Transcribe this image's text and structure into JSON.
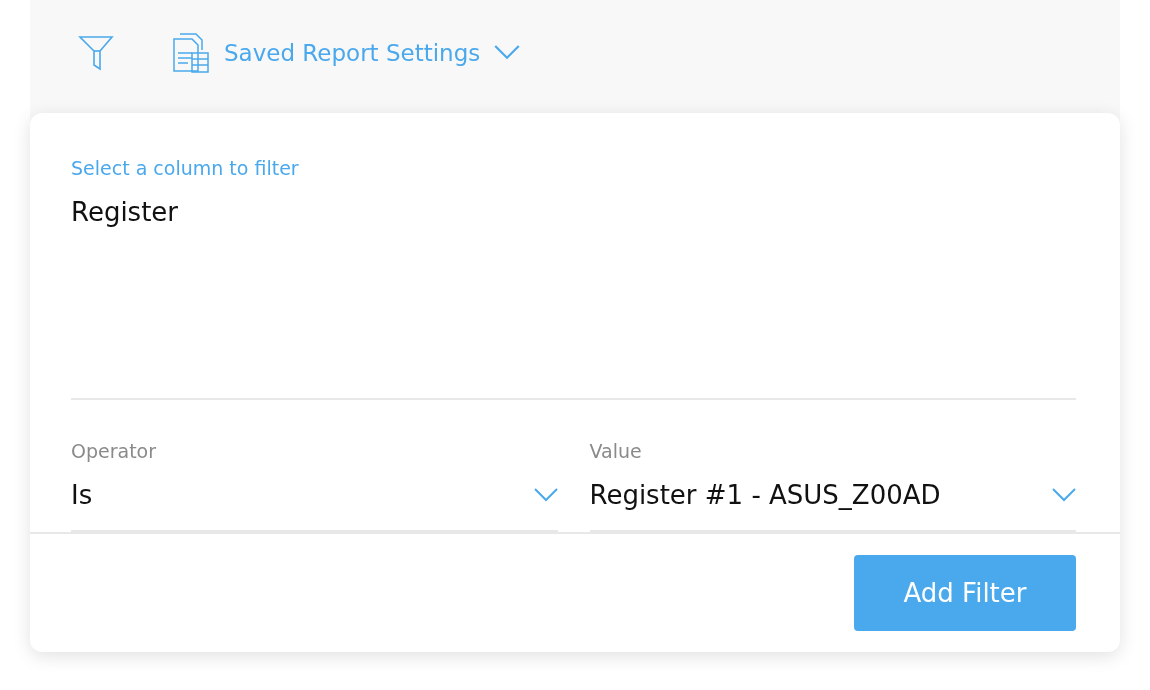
{
  "toolbar": {
    "saved_settings": "Saved Report Settings"
  },
  "filter_form": {
    "column": {
      "label": "Select a column to filter",
      "value": "Register",
      "focused": true
    },
    "operator": {
      "label": "Operator",
      "value": "Is",
      "focused": false
    },
    "value": {
      "label": "Value",
      "value": "Register #1 - ASUS_Z00AD",
      "focused": false
    },
    "submit": "Add Filter"
  }
}
